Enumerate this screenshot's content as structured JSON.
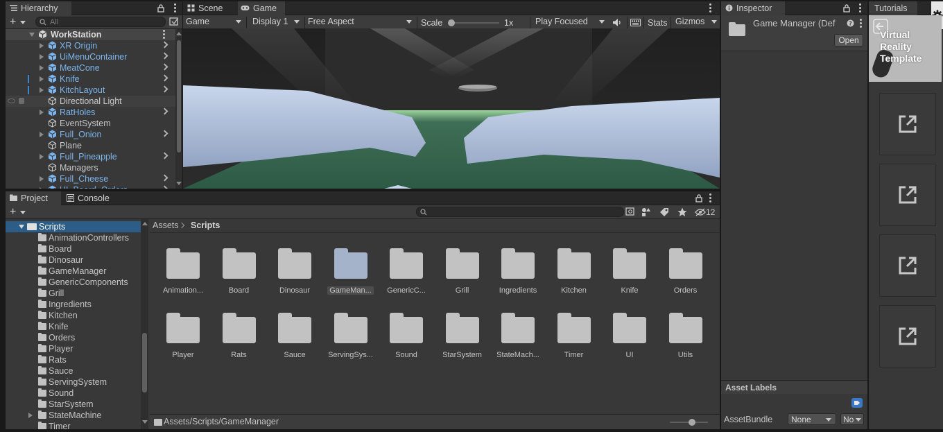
{
  "hierarchy": {
    "tab": "Hierarchy",
    "search_placeholder": "All",
    "root": "WorkStation",
    "items": [
      {
        "label": "XR Origin",
        "prefab": true,
        "children": true
      },
      {
        "label": "UiMenuContainer",
        "prefab": true,
        "children": true
      },
      {
        "label": "MeatCone",
        "prefab": true,
        "children": true
      },
      {
        "label": "Knife",
        "prefab": true,
        "children": true
      },
      {
        "label": "KitchLayout",
        "prefab": true,
        "children": true
      },
      {
        "label": "Directional Light",
        "prefab": false,
        "children": false
      },
      {
        "label": "RatHoles",
        "prefab": true,
        "children": true
      },
      {
        "label": "EventSystem",
        "prefab": false,
        "children": false
      },
      {
        "label": "Full_Onion",
        "prefab": true,
        "children": true
      },
      {
        "label": "Plane",
        "prefab": false,
        "children": false
      },
      {
        "label": "Full_Pineapple",
        "prefab": true,
        "children": true
      },
      {
        "label": "Managers",
        "prefab": false,
        "children": false
      },
      {
        "label": "Full_Cheese",
        "prefab": true,
        "children": true
      },
      {
        "label": "UI_Board_Orders",
        "prefab": true,
        "children": true
      }
    ]
  },
  "scene_tabs": {
    "scene": "Scene",
    "game": "Game"
  },
  "game_toolbar": {
    "mode": "Game",
    "display": "Display 1",
    "aspect": "Free Aspect",
    "scale_label": "Scale",
    "scale_value": "1x",
    "play_mode": "Play Focused",
    "stats": "Stats",
    "gizmos": "Gizmos"
  },
  "inspector": {
    "tab": "Inspector",
    "title": "Game Manager (Def",
    "open_button": "Open",
    "asset_labels": "Asset Labels",
    "asset_bundle_label": "AssetBundle",
    "asset_bundle_value": "None",
    "variant_value": "No"
  },
  "tutorials": {
    "tab": "Tutorials",
    "card_title": "Virtual Reality Template"
  },
  "project": {
    "tab_project": "Project",
    "tab_console": "Console",
    "hidden_count": "12",
    "breadcrumb": [
      "Assets",
      "Scripts"
    ],
    "tree_root": "Scripts",
    "tree_items": [
      {
        "label": "AnimationControllers",
        "expandable": false
      },
      {
        "label": "Board",
        "expandable": false
      },
      {
        "label": "Dinosaur",
        "expandable": false
      },
      {
        "label": "GameManager",
        "expandable": false
      },
      {
        "label": "GenericComponents",
        "expandable": false
      },
      {
        "label": "Grill",
        "expandable": false
      },
      {
        "label": "Ingredients",
        "expandable": false
      },
      {
        "label": "Kitchen",
        "expandable": false
      },
      {
        "label": "Knife",
        "expandable": false
      },
      {
        "label": "Orders",
        "expandable": false
      },
      {
        "label": "Player",
        "expandable": false
      },
      {
        "label": "Rats",
        "expandable": false
      },
      {
        "label": "Sauce",
        "expandable": false
      },
      {
        "label": "ServingSystem",
        "expandable": false
      },
      {
        "label": "Sound",
        "expandable": false
      },
      {
        "label": "StarSystem",
        "expandable": false
      },
      {
        "label": "StateMachine",
        "expandable": true
      },
      {
        "label": "Timer",
        "expandable": false
      }
    ],
    "grid": [
      {
        "label": "Animation...",
        "selected": false
      },
      {
        "label": "Board",
        "selected": false
      },
      {
        "label": "Dinosaur",
        "selected": false
      },
      {
        "label": "GameMan...",
        "selected": true
      },
      {
        "label": "GenericC...",
        "selected": false
      },
      {
        "label": "Grill",
        "selected": false
      },
      {
        "label": "Ingredients",
        "selected": false
      },
      {
        "label": "Kitchen",
        "selected": false
      },
      {
        "label": "Knife",
        "selected": false
      },
      {
        "label": "Orders",
        "selected": false
      },
      {
        "label": "Player",
        "selected": false
      },
      {
        "label": "Rats",
        "selected": false
      },
      {
        "label": "Sauce",
        "selected": false
      },
      {
        "label": "ServingSys...",
        "selected": false
      },
      {
        "label": "Sound",
        "selected": false
      },
      {
        "label": "StarSystem",
        "selected": false
      },
      {
        "label": "StateMach...",
        "selected": false
      },
      {
        "label": "Timer",
        "selected": false
      },
      {
        "label": "UI",
        "selected": false
      },
      {
        "label": "Utils",
        "selected": false
      }
    ],
    "status_path": "Assets/Scripts/GameManager"
  },
  "colors": {
    "prefab_blue": "#7cb5ec",
    "selection_blue": "#2c5d87",
    "panel_bg": "#383838",
    "folder_grey": "#c2c2c2",
    "folder_selected": "#a4b2ca"
  }
}
